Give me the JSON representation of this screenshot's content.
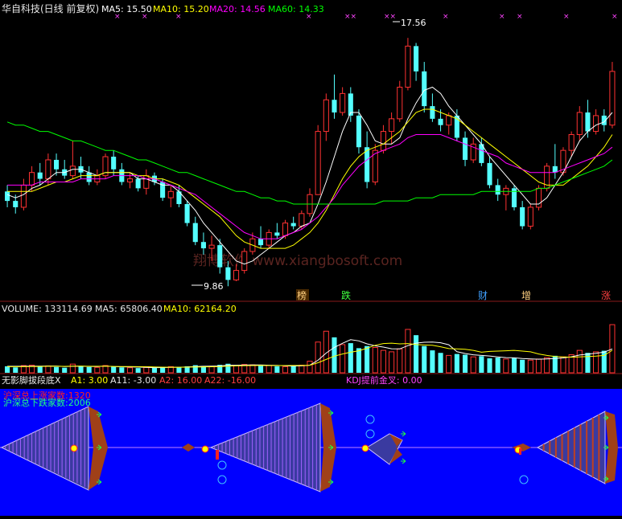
{
  "header": {
    "title": "华自科技(日线 前复权)",
    "ma5": "MA5: 15.50",
    "ma10": "MA10: 15.20",
    "ma20": "MA20: 14.56",
    "ma60": "MA60: 14.33"
  },
  "price_annotations": {
    "high": "17.56",
    "low": "9.86"
  },
  "watermark": "翔博软件 www.xiangbosoft.com",
  "event_markers": [
    "榜",
    "跌",
    "财",
    "增",
    "涨"
  ],
  "volume_header": {
    "volume": "VOLUME: 133114.69",
    "ma5": "MA5: 65806.40",
    "ma10": "MA10: 62164.20"
  },
  "indicator_header": {
    "name": "无影脚拔段底X",
    "a1": "A1: 3.00",
    "a11": "A11: -3.00",
    "a2": "A2: 16.00",
    "a22": "A22: -16.00",
    "kdj": "KDJ提前金叉: 0.00"
  },
  "indicator_labels": {
    "up_count": "沪深总上涨家数:1320",
    "down_count": "沪深总下跌家数:2006"
  },
  "colors": {
    "up": "#ff3232",
    "down": "#54ffff",
    "ma5": "#ffffff",
    "ma10": "#ffff00",
    "ma20": "#ff00ff",
    "ma60": "#00ff00",
    "indicator_bg": "#0000ff"
  },
  "chart_data": [
    {
      "type": "candlestick",
      "title": "华自科技(日线 前复权)",
      "ylim": [
        9.3,
        18.2
      ],
      "ohlc": [
        [
          12.7,
          12.9,
          12.2,
          12.4
        ],
        [
          12.4,
          12.6,
          12.0,
          12.2
        ],
        [
          12.2,
          13.1,
          12.1,
          12.9
        ],
        [
          12.9,
          13.5,
          12.7,
          13.3
        ],
        [
          13.3,
          13.6,
          12.9,
          13.1
        ],
        [
          13.1,
          13.9,
          12.9,
          13.7
        ],
        [
          13.7,
          13.9,
          13.2,
          13.4
        ],
        [
          13.4,
          13.7,
          13.1,
          13.2
        ],
        [
          13.2,
          14.3,
          13.1,
          13.5
        ],
        [
          13.5,
          13.8,
          13.1,
          13.3
        ],
        [
          13.3,
          13.5,
          12.9,
          13.0
        ],
        [
          13.0,
          13.4,
          12.9,
          13.2
        ],
        [
          13.2,
          13.9,
          13.1,
          13.8
        ],
        [
          13.8,
          14.0,
          13.2,
          13.4
        ],
        [
          13.4,
          13.6,
          12.9,
          13.0
        ],
        [
          13.0,
          13.3,
          12.8,
          13.1
        ],
        [
          13.1,
          13.2,
          12.7,
          12.8
        ],
        [
          12.8,
          13.4,
          12.6,
          13.2
        ],
        [
          13.2,
          13.3,
          12.9,
          13.0
        ],
        [
          13.0,
          13.1,
          12.4,
          12.5
        ],
        [
          12.5,
          12.9,
          12.2,
          12.7
        ],
        [
          12.7,
          12.9,
          12.2,
          12.3
        ],
        [
          12.3,
          12.4,
          11.6,
          11.7
        ],
        [
          11.7,
          11.9,
          11.0,
          11.1
        ],
        [
          11.1,
          11.4,
          10.7,
          10.9
        ],
        [
          10.9,
          11.3,
          10.5,
          11.0
        ],
        [
          11.0,
          11.2,
          10.1,
          10.3
        ],
        [
          10.3,
          10.5,
          9.7,
          9.9
        ],
        [
          9.9,
          10.4,
          9.86,
          10.2
        ],
        [
          10.2,
          10.9,
          10.1,
          10.8
        ],
        [
          10.8,
          11.4,
          10.7,
          11.2
        ],
        [
          11.2,
          11.6,
          10.9,
          11.0
        ],
        [
          11.0,
          11.5,
          10.9,
          11.4
        ],
        [
          11.4,
          11.7,
          11.2,
          11.3
        ],
        [
          11.3,
          11.8,
          11.2,
          11.7
        ],
        [
          11.7,
          11.9,
          11.5,
          11.6
        ],
        [
          11.6,
          12.1,
          11.5,
          12.0
        ],
        [
          12.0,
          12.8,
          11.9,
          12.6
        ],
        [
          12.6,
          14.8,
          12.6,
          14.6
        ],
        [
          14.6,
          15.8,
          14.3,
          15.6
        ],
        [
          15.6,
          16.4,
          15.0,
          15.2
        ],
        [
          15.2,
          16.0,
          15.1,
          15.8
        ],
        [
          15.8,
          16.0,
          14.9,
          15.1
        ],
        [
          15.1,
          15.3,
          13.9,
          14.1
        ],
        [
          14.1,
          14.6,
          12.8,
          13.0
        ],
        [
          13.0,
          14.2,
          12.9,
          14.0
        ],
        [
          14.0,
          14.8,
          13.9,
          14.6
        ],
        [
          14.6,
          15.2,
          14.2,
          15.0
        ],
        [
          15.0,
          16.2,
          14.9,
          16.0
        ],
        [
          16.0,
          17.56,
          15.9,
          17.3
        ],
        [
          17.3,
          17.4,
          16.2,
          16.5
        ],
        [
          16.5,
          16.8,
          15.2,
          15.4
        ],
        [
          15.4,
          15.8,
          14.9,
          15.0
        ],
        [
          15.0,
          15.3,
          14.6,
          14.8
        ],
        [
          14.8,
          15.2,
          14.5,
          15.1
        ],
        [
          15.1,
          15.3,
          14.3,
          14.4
        ],
        [
          14.4,
          14.6,
          13.5,
          13.7
        ],
        [
          13.7,
          14.4,
          13.6,
          14.2
        ],
        [
          14.2,
          14.4,
          13.5,
          13.6
        ],
        [
          13.6,
          13.8,
          12.8,
          12.9
        ],
        [
          12.9,
          13.1,
          12.4,
          12.6
        ],
        [
          12.6,
          12.9,
          12.1,
          12.8
        ],
        [
          12.8,
          12.9,
          12.1,
          12.2
        ],
        [
          12.2,
          12.4,
          11.5,
          11.6
        ],
        [
          11.6,
          12.3,
          11.5,
          12.2
        ],
        [
          12.2,
          12.9,
          12.1,
          12.8
        ],
        [
          12.8,
          13.6,
          12.7,
          13.5
        ],
        [
          13.5,
          14.2,
          13.1,
          13.3
        ],
        [
          13.3,
          14.1,
          13.2,
          14.0
        ],
        [
          14.0,
          14.6,
          13.8,
          14.5
        ],
        [
          14.5,
          15.4,
          14.3,
          15.2
        ],
        [
          15.2,
          15.6,
          14.4,
          14.6
        ],
        [
          14.6,
          15.3,
          14.5,
          15.1
        ],
        [
          15.1,
          15.3,
          14.6,
          14.8
        ],
        [
          14.8,
          16.8,
          14.7,
          16.5
        ]
      ],
      "ma": {
        "MA5": [
          12.6,
          12.5,
          12.6,
          12.8,
          12.9,
          13.1,
          13.3,
          13.3,
          13.4,
          13.4,
          13.3,
          13.2,
          13.3,
          13.3,
          13.3,
          13.3,
          13.1,
          13.1,
          13.0,
          12.9,
          12.9,
          12.7,
          12.4,
          12.1,
          11.7,
          11.4,
          11.1,
          10.8,
          10.5,
          10.4,
          10.5,
          10.7,
          10.9,
          11.1,
          11.3,
          11.4,
          11.6,
          11.7,
          12.3,
          13.0,
          13.8,
          14.6,
          15.2,
          15.2,
          14.8,
          14.3,
          14.2,
          14.2,
          14.4,
          15.0,
          15.5,
          15.9,
          16.0,
          15.8,
          15.4,
          15.1,
          14.8,
          14.5,
          14.2,
          13.8,
          13.5,
          13.2,
          12.9,
          12.6,
          12.3,
          12.3,
          12.5,
          12.9,
          13.3,
          13.8,
          14.3,
          14.6,
          14.8,
          14.9,
          15.2
        ],
        "MA10": [
          12.7,
          12.7,
          12.7,
          12.7,
          12.8,
          12.9,
          13.0,
          13.0,
          13.1,
          13.2,
          13.2,
          13.2,
          13.3,
          13.3,
          13.3,
          13.3,
          13.2,
          13.2,
          13.1,
          13.1,
          13.0,
          12.9,
          12.7,
          12.5,
          12.3,
          12.1,
          11.9,
          11.6,
          11.3,
          11.1,
          11.0,
          10.9,
          10.9,
          10.9,
          10.9,
          11.0,
          11.2,
          11.4,
          11.7,
          12.1,
          12.6,
          13.1,
          13.5,
          13.8,
          14.0,
          14.1,
          14.2,
          14.4,
          14.6,
          14.9,
          15.2,
          15.3,
          15.3,
          15.2,
          15.1,
          15.0,
          14.8,
          14.6,
          14.4,
          14.2,
          14.0,
          13.8,
          13.6,
          13.4,
          13.2,
          13.0,
          12.9,
          12.9,
          12.9,
          13.1,
          13.3,
          13.5,
          13.8,
          14.1,
          14.5
        ],
        "MA20": [
          12.9,
          12.9,
          12.9,
          12.9,
          13.0,
          13.0,
          13.0,
          13.0,
          13.0,
          13.1,
          13.1,
          13.1,
          13.1,
          13.2,
          13.2,
          13.2,
          13.2,
          13.1,
          13.1,
          13.0,
          12.9,
          12.8,
          12.7,
          12.6,
          12.4,
          12.2,
          12.0,
          11.8,
          11.6,
          11.4,
          11.3,
          11.2,
          11.2,
          11.2,
          11.3,
          11.4,
          11.5,
          11.7,
          11.9,
          12.2,
          12.5,
          12.9,
          13.2,
          13.5,
          13.7,
          13.9,
          14.0,
          14.1,
          14.2,
          14.4,
          14.5,
          14.5,
          14.5,
          14.5,
          14.4,
          14.3,
          14.2,
          14.1,
          14.0,
          13.9,
          13.8,
          13.6,
          13.5,
          13.4,
          13.3,
          13.3,
          13.3,
          13.3,
          13.4,
          13.5,
          13.6,
          13.7,
          13.8,
          13.9,
          14.1
        ],
        "MA60": [
          14.9,
          14.8,
          14.8,
          14.7,
          14.6,
          14.6,
          14.5,
          14.4,
          14.3,
          14.3,
          14.2,
          14.1,
          14.0,
          14.0,
          13.9,
          13.8,
          13.7,
          13.7,
          13.6,
          13.5,
          13.4,
          13.3,
          13.3,
          13.2,
          13.1,
          13.0,
          12.9,
          12.8,
          12.7,
          12.7,
          12.6,
          12.5,
          12.5,
          12.4,
          12.4,
          12.3,
          12.3,
          12.3,
          12.3,
          12.3,
          12.3,
          12.3,
          12.3,
          12.3,
          12.3,
          12.3,
          12.4,
          12.4,
          12.4,
          12.4,
          12.5,
          12.5,
          12.5,
          12.6,
          12.6,
          12.6,
          12.6,
          12.6,
          12.7,
          12.7,
          12.7,
          12.7,
          12.7,
          12.7,
          12.7,
          12.8,
          12.8,
          12.9,
          13.0,
          13.1,
          13.2,
          13.3,
          13.4,
          13.5,
          13.7
        ]
      }
    },
    {
      "type": "bar",
      "title": "VOLUME",
      "ylim": [
        0,
        160000
      ],
      "values": [
        18000,
        15000,
        20000,
        21000,
        17000,
        19000,
        16000,
        14000,
        24000,
        18000,
        16000,
        15000,
        20000,
        17000,
        15000,
        14000,
        13000,
        15000,
        14000,
        16000,
        17000,
        15000,
        18000,
        21000,
        19000,
        18000,
        22000,
        25000,
        20000,
        23000,
        22000,
        19000,
        20000,
        18000,
        17000,
        19000,
        21000,
        32000,
        85000,
        115000,
        98000,
        78000,
        82000,
        68000,
        74000,
        70000,
        62000,
        58000,
        66000,
        120000,
        104000,
        74000,
        62000,
        55000,
        48000,
        52000,
        50000,
        44000,
        46000,
        40000,
        42000,
        38000,
        41000,
        36000,
        35000,
        38000,
        42000,
        47000,
        44000,
        50000,
        62000,
        55000,
        58000,
        61000,
        133114
      ],
      "ma": {
        "MA5": [
          18000,
          18000,
          18000,
          18200,
          18200,
          18600,
          18600,
          17200,
          18000,
          18200,
          17600,
          17400,
          18600,
          17200,
          16600,
          16200,
          15800,
          15200,
          14200,
          14400,
          15000,
          15400,
          16000,
          17400,
          18000,
          18200,
          18800,
          21000,
          20800,
          21400,
          21600,
          21800,
          20800,
          20400,
          19200,
          18600,
          19000,
          21000,
          34600,
          54400,
          70200,
          81600,
          91600,
          88200,
          80000,
          74400,
          71200,
          66400,
          66000,
          75200,
          82000,
          84400,
          85200,
          83000,
          77600,
          58200,
          53400,
          49800,
          48000,
          46400,
          44000,
          42000,
          41400,
          39400,
          38400,
          37600,
          38400,
          39600,
          41200,
          44200,
          49000,
          51600,
          54000,
          57200,
          65806
        ],
        "MA10": [
          17000,
          17000,
          17000,
          17200,
          17600,
          18000,
          18000,
          17800,
          18200,
          18400,
          18100,
          18000,
          18300,
          17600,
          17300,
          17200,
          17000,
          16900,
          16000,
          15500,
          15400,
          15400,
          15500,
          16000,
          16300,
          16600,
          17100,
          18500,
          19100,
          19800,
          20100,
          20300,
          19900,
          20000,
          20000,
          20200,
          20300,
          21000,
          27800,
          37000,
          46000,
          52000,
          57000,
          61000,
          68000,
          76000,
          81000,
          82000,
          80000,
          81000,
          78000,
          77000,
          76000,
          72000,
          67000,
          66000,
          65000,
          62000,
          57000,
          59000,
          60000,
          61000,
          62000,
          60000,
          58000,
          52000,
          48000,
          45000,
          44000,
          43000,
          44000,
          45000,
          46000,
          48000,
          62164
        ]
      }
    }
  ]
}
